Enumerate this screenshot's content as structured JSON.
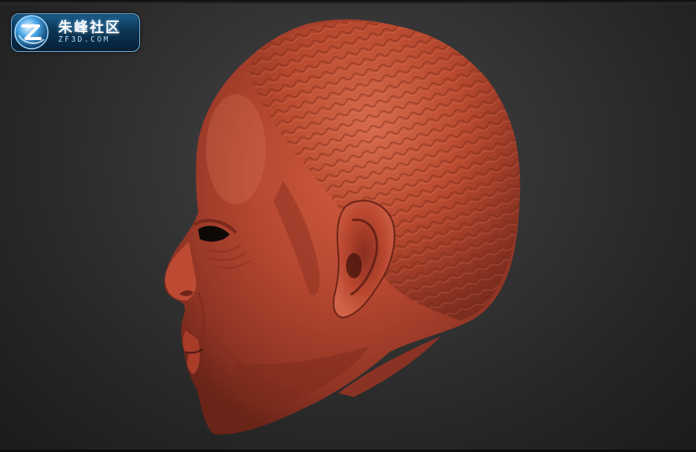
{
  "logo": {
    "icon": "z-swirl-logo-icon",
    "title_cn": "朱峰社区",
    "site_url": "ZF3D.COM"
  },
  "viewport": {
    "background_color": "#2e2e2e",
    "model_color": "#b5432f",
    "subject": "sculpted-head-side-view"
  }
}
